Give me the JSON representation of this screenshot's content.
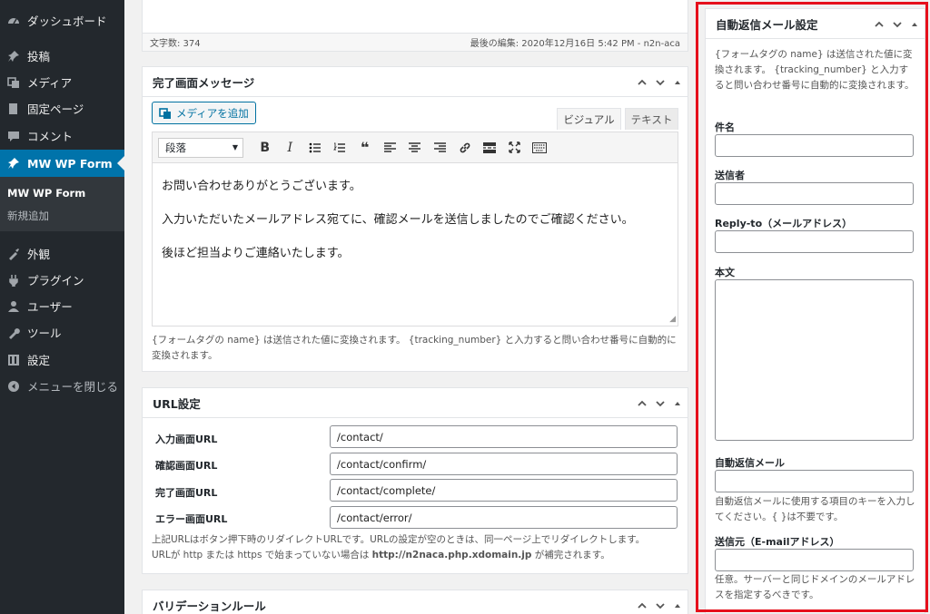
{
  "sidebar": {
    "items": [
      {
        "label": "ダッシュボード",
        "icon": "dashboard-icon"
      },
      {
        "label": "投稿",
        "icon": "pin-icon"
      },
      {
        "label": "メディア",
        "icon": "media-icon"
      },
      {
        "label": "固定ページ",
        "icon": "page-icon"
      },
      {
        "label": "コメント",
        "icon": "comment-icon"
      },
      {
        "label": "MW WP Form",
        "icon": "pin-icon",
        "active": true
      },
      {
        "label": "外観",
        "icon": "appearance-icon"
      },
      {
        "label": "プラグイン",
        "icon": "plugin-icon"
      },
      {
        "label": "ユーザー",
        "icon": "user-icon"
      },
      {
        "label": "ツール",
        "icon": "wrench-icon"
      },
      {
        "label": "設定",
        "icon": "settings-icon"
      },
      {
        "label": "メニューを閉じる",
        "icon": "collapse-icon"
      }
    ],
    "submenu": [
      {
        "label": "MW WP Form",
        "current": true
      },
      {
        "label": "新規追加"
      }
    ]
  },
  "editor_status": {
    "word_count": "文字数: 374",
    "last_edited": "最後の編集: 2020年12月16日 5:42 PM - n2n-aca"
  },
  "complete_message": {
    "title": "完了画面メッセージ",
    "add_media": "メディアを追加",
    "tab_visual": "ビジュアル",
    "tab_text": "テキスト",
    "format_select": "段落",
    "paragraphs": [
      "お問い合わせありがとうございます。",
      "入力いただいたメールアドレス宛てに、確認メールを送信しましたのでご確認ください。",
      "後ほど担当よりご連絡いたします。"
    ],
    "note": "{フォームタグの name} は送信された値に変換されます。 {tracking_number} と入力すると問い合わせ番号に自動的に変換されます。"
  },
  "url_settings": {
    "title": "URL設定",
    "rows": [
      {
        "label": "入力画面URL",
        "value": "/contact/"
      },
      {
        "label": "確認画面URL",
        "value": "/contact/confirm/"
      },
      {
        "label": "完了画面URL",
        "value": "/contact/complete/"
      },
      {
        "label": "エラー画面URL",
        "value": "/contact/error/"
      }
    ],
    "note_line1": "上記URLはボタン押下時のリダイレクトURLです。URLの設定が空のときは、同一ページ上でリダイレクトします。",
    "note_line2_pre": "URLが http または https で始まっていない場合は ",
    "note_line2_url": "http://n2naca.php.xdomain.jp",
    "note_line2_post": " が補完されます。"
  },
  "validation": {
    "title": "バリデーションルール"
  },
  "auto_reply": {
    "title": "自動返信メール設定",
    "intro": "{フォームタグの name} は送信された値に変換されます。 {tracking_number} と入力すると問い合わせ番号に自動的に変換されます。",
    "subject_label": "件名",
    "sender_label": "送信者",
    "reply_to_label": "Reply-to（メールアドレス）",
    "body_label": "本文",
    "auto_reply_mail_label": "自動返信メール",
    "auto_reply_mail_help": "自動返信メールに使用する項目のキーを入力してください。{ }は不要です。",
    "from_label": "送信元（E-mailアドレス）",
    "from_help": "任意。サーバーと同じドメインのメールアドレスを指定するべきです。"
  },
  "colors": {
    "accent": "#0073aa",
    "highlight_frame": "#e6101c",
    "sidebar_bg": "#23282d"
  }
}
